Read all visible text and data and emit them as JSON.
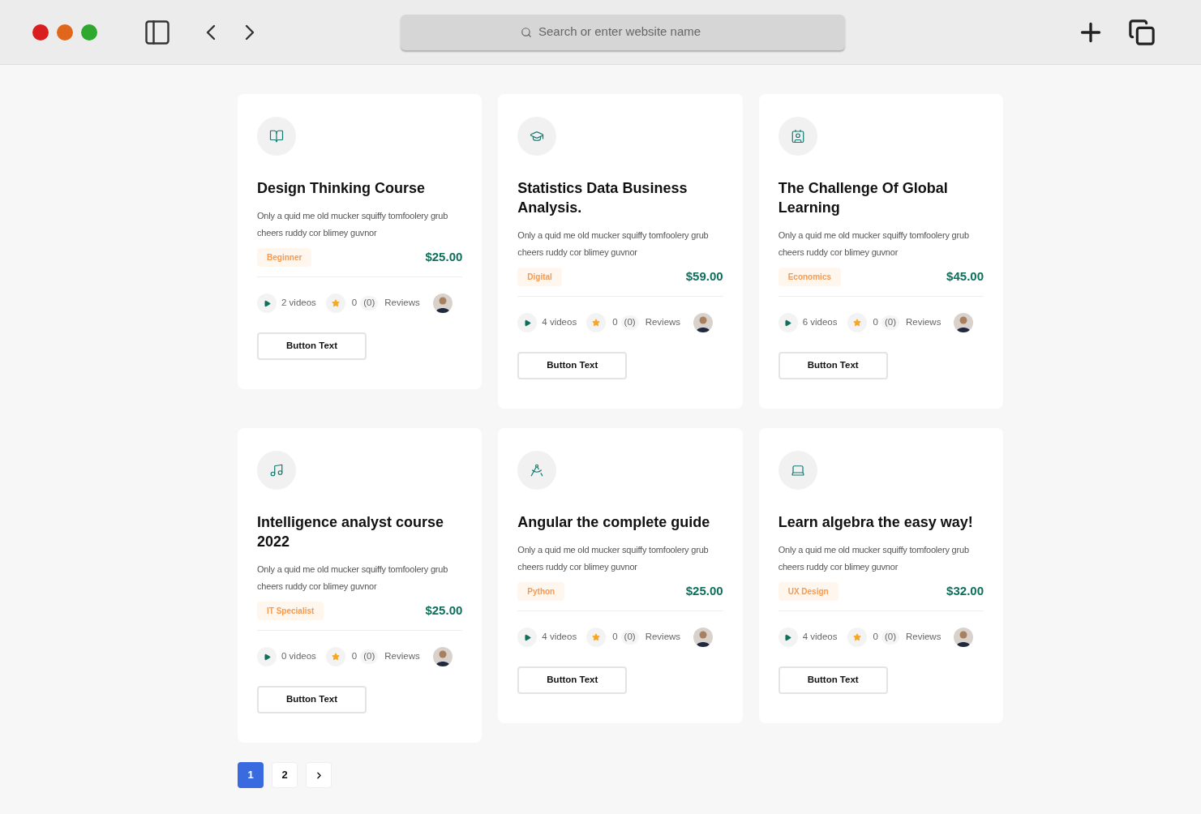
{
  "browser": {
    "address_placeholder": "Search or enter website name"
  },
  "courses": [
    {
      "title": "Design Thinking Course",
      "description": "Only a quid me old mucker squiffy tomfoolery grub cheers ruddy cor blimey guvnor",
      "tag": "Beginner",
      "price": "$25.00",
      "videos": "2 videos",
      "rating": "0",
      "review_count": "(0)",
      "reviews_label": "Reviews",
      "button": "Button Text"
    },
    {
      "title": "Statistics Data Business Analysis.",
      "description": "Only a quid me old mucker squiffy tomfoolery grub cheers ruddy cor blimey guvnor",
      "tag": "Digital",
      "price": "$59.00",
      "videos": "4 videos",
      "rating": "0",
      "review_count": "(0)",
      "reviews_label": "Reviews",
      "button": "Button Text"
    },
    {
      "title": "The Challenge Of Global Learning",
      "description": "Only a quid me old mucker squiffy tomfoolery grub cheers ruddy cor blimey guvnor",
      "tag": "Economics",
      "price": "$45.00",
      "videos": "6 videos",
      "rating": "0",
      "review_count": "(0)",
      "reviews_label": "Reviews",
      "button": "Button Text"
    },
    {
      "title": "Intelligence analyst course 2022",
      "description": "Only a quid me old mucker squiffy tomfoolery grub cheers ruddy cor blimey guvnor",
      "tag": "IT Specialist",
      "price": "$25.00",
      "videos": "0 videos",
      "rating": "0",
      "review_count": "(0)",
      "reviews_label": "Reviews",
      "button": "Button Text"
    },
    {
      "title": "Angular the complete guide",
      "description": "Only a quid me old mucker squiffy tomfoolery grub cheers ruddy cor blimey guvnor",
      "tag": "Python",
      "price": "$25.00",
      "videos": "4 videos",
      "rating": "0",
      "review_count": "(0)",
      "reviews_label": "Reviews",
      "button": "Button Text"
    },
    {
      "title": "Learn algebra the easy way!",
      "description": "Only a quid me old mucker squiffy tomfoolery grub cheers ruddy cor blimey guvnor",
      "tag": "UX Design",
      "price": "$32.00",
      "videos": "4 videos",
      "rating": "0",
      "review_count": "(0)",
      "reviews_label": "Reviews",
      "button": "Button Text"
    }
  ],
  "pagination": {
    "pages": [
      {
        "label": "1",
        "selected": true
      },
      {
        "label": "2",
        "selected": false
      }
    ]
  }
}
